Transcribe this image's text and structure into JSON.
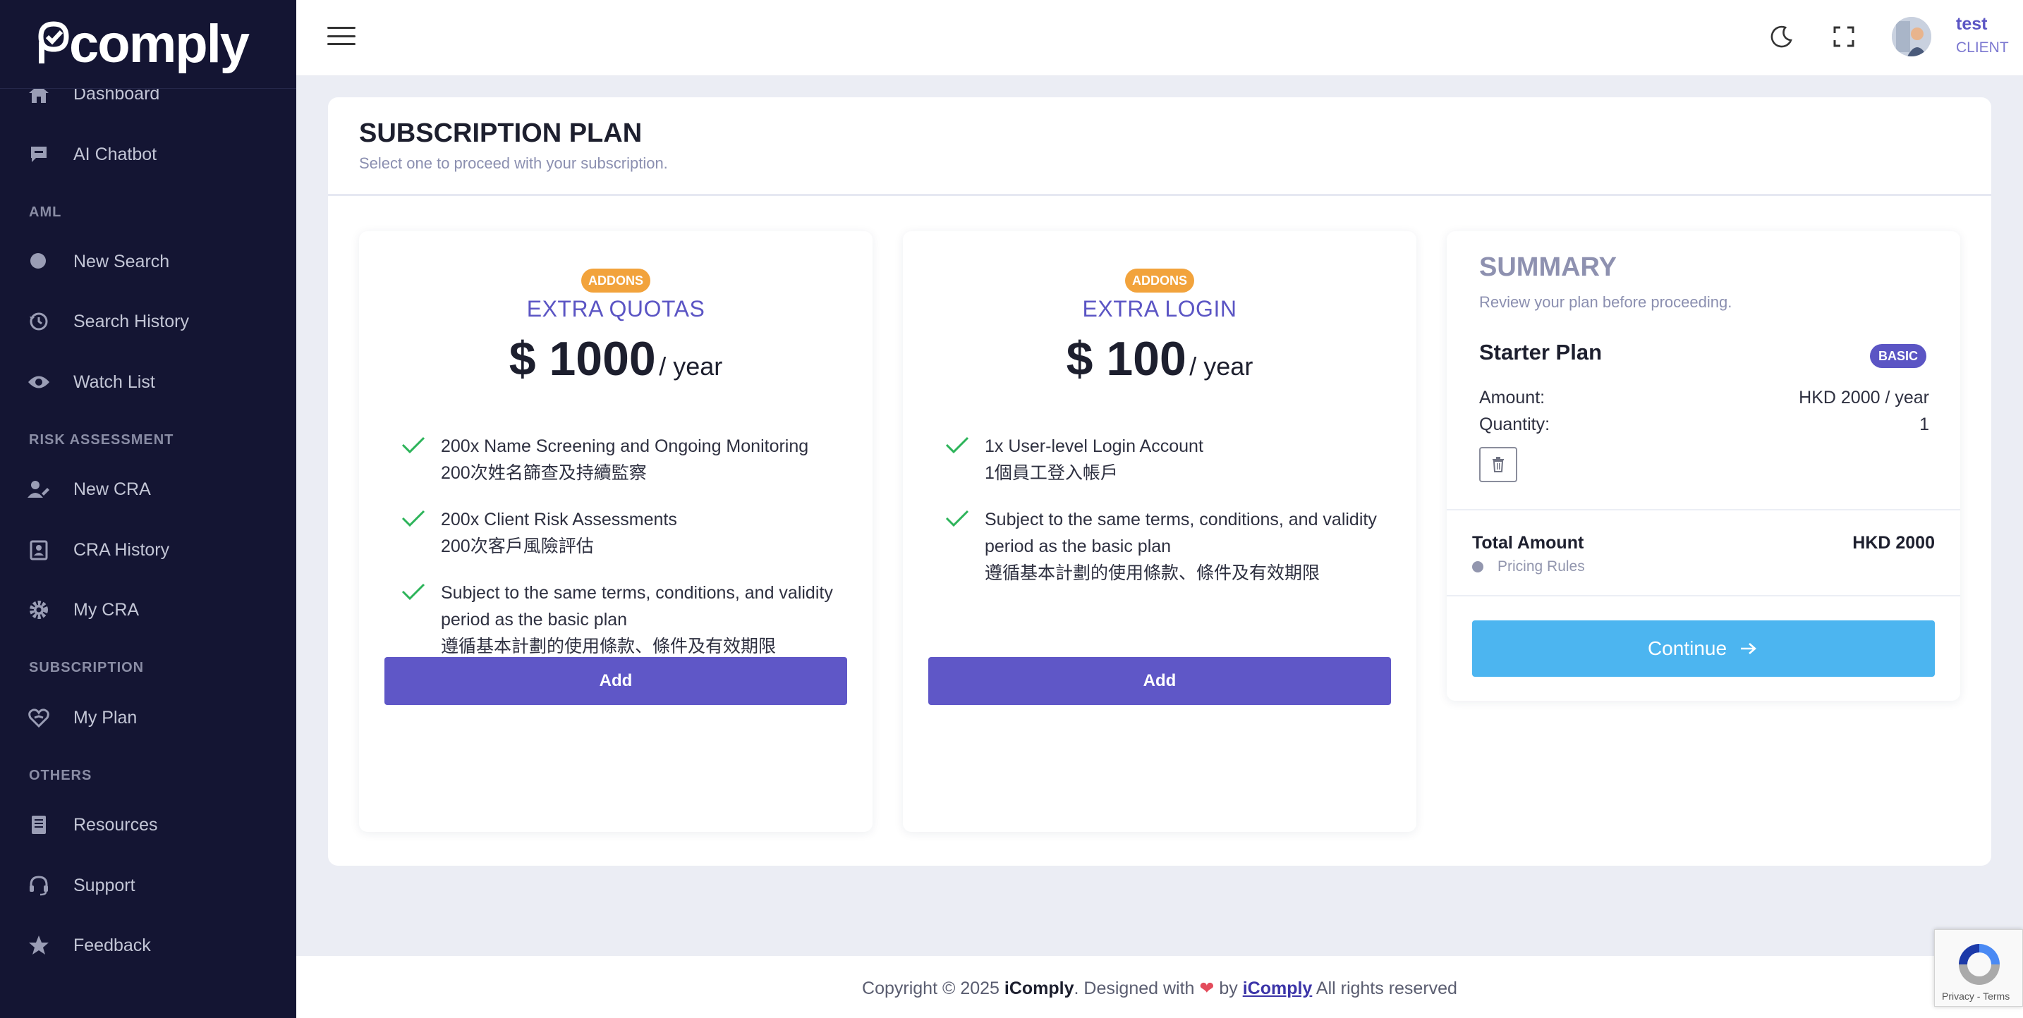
{
  "brand": {
    "name": "comply"
  },
  "sidebar": {
    "items": [
      {
        "label": "Dashboard",
        "icon": "home-icon"
      },
      {
        "label": "AI Chatbot",
        "icon": "chat-icon"
      },
      {
        "label": "New Search",
        "icon": "search-icon"
      },
      {
        "label": "Search History",
        "icon": "history-icon"
      },
      {
        "label": "Watch List",
        "icon": "eye-icon"
      },
      {
        "label": "New CRA",
        "icon": "user-edit-icon"
      },
      {
        "label": "CRA History",
        "icon": "contact-card-icon"
      },
      {
        "label": "My CRA",
        "icon": "gear-icon"
      },
      {
        "label": "My Plan",
        "icon": "heart-hand-icon"
      },
      {
        "label": "Resources",
        "icon": "book-icon"
      },
      {
        "label": "Support",
        "icon": "headset-icon"
      },
      {
        "label": "Feedback",
        "icon": "star-icon"
      }
    ],
    "sections": {
      "aml": "AML",
      "risk": "RISK ASSESSMENT",
      "subscription": "SUBSCRIPTION",
      "others": "OTHERS"
    }
  },
  "topbar": {
    "user_name": "test",
    "user_role": "CLIENT"
  },
  "page": {
    "title": "SUBSCRIPTION PLAN",
    "subtitle": "Select one to proceed with your subscription."
  },
  "plans": [
    {
      "badge": "ADDONS",
      "name": "EXTRA QUOTAS",
      "price": "$ 1000",
      "period": "/ year",
      "features": [
        {
          "line1": "200x Name Screening and Ongoing Monitoring",
          "line2": "200次姓名篩查及持續監察"
        },
        {
          "line1": "200x Client Risk Assessments",
          "line2": "200次客戶風險評估"
        },
        {
          "line1": "Subject to the same terms, conditions, and validity",
          "line1b": "period as the basic plan",
          "line2": "遵循基本計劃的使用條款、條件及有效期限"
        }
      ],
      "button": "Add"
    },
    {
      "badge": "ADDONS",
      "name": "EXTRA LOGIN",
      "price": "$ 100",
      "period": "/ year",
      "features": [
        {
          "line1": "1x User-level Login Account",
          "line2": "1個員工登入帳戶"
        },
        {
          "line1": "Subject to the same terms, conditions, and validity",
          "line1b": "period as the basic plan",
          "line2": "遵循基本計劃的使用條款、條件及有效期限"
        }
      ],
      "button": "Add"
    }
  ],
  "summary": {
    "title": "SUMMARY",
    "subtitle": "Review your plan before proceeding.",
    "plan_name": "Starter Plan",
    "plan_badge": "BASIC",
    "amount_label": "Amount:",
    "amount_value": "HKD 2000 / year",
    "quantity_label": "Quantity:",
    "quantity_value": "1",
    "total_label": "Total Amount",
    "total_value": "HKD 2000",
    "pricing_rules": "Pricing Rules",
    "continue": "Continue"
  },
  "footer": {
    "prefix": "Copyright © 2025",
    "brand": "iComply",
    "designed": ". Designed with",
    "by": "by",
    "link": "iComply",
    "suffix": "All rights reserved"
  },
  "recaptcha": {
    "text": "Privacy - Terms"
  },
  "colors": {
    "accent": "#5f57c7",
    "sidebar": "#141533",
    "continue": "#4cb5f0",
    "addon_badge": "#f2a33c"
  }
}
